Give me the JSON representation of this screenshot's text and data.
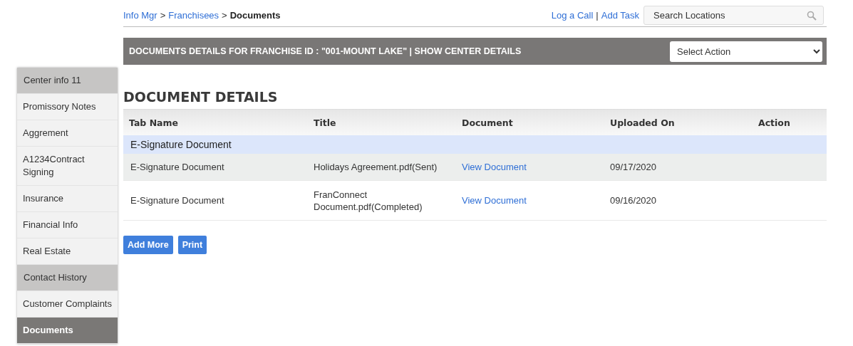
{
  "breadcrumb": {
    "items": [
      {
        "kind": "link",
        "label": "Info Mgr"
      },
      {
        "kind": "sep",
        "label": ">"
      },
      {
        "kind": "link",
        "label": "Franchisees"
      },
      {
        "kind": "sep",
        "label": ">"
      },
      {
        "kind": "current",
        "label": "Documents"
      }
    ]
  },
  "header_links": [
    {
      "kind": "link",
      "label": "Log a Call"
    },
    {
      "kind": "sep",
      "label": "|"
    },
    {
      "kind": "link",
      "label": "Add Task"
    }
  ],
  "search": {
    "placeholder": "Search Locations"
  },
  "title_bar": {
    "title": "DOCUMENTS DETAILS FOR FRANCHISE ID : \"001-MOUNT LAKE\" | SHOW CENTER DETAILS",
    "action_select": "Select Action"
  },
  "sidebar": {
    "items": [
      {
        "kind": "header",
        "label": "Center info 11",
        "selected": false
      },
      {
        "kind": "item",
        "label": "Promissory Notes",
        "selected": false
      },
      {
        "kind": "item",
        "label": "Aggrement",
        "selected": false
      },
      {
        "kind": "item",
        "label": "A1234Contract Signing",
        "selected": false
      },
      {
        "kind": "item",
        "label": "Insurance",
        "selected": false
      },
      {
        "kind": "item",
        "label": "Financial Info",
        "selected": false
      },
      {
        "kind": "item",
        "label": "Real Estate",
        "selected": false
      },
      {
        "kind": "header",
        "label": "Contact History",
        "selected": false
      },
      {
        "kind": "item",
        "label": "Customer Complaints",
        "selected": false
      },
      {
        "kind": "item",
        "label": "Documents",
        "selected": true
      }
    ]
  },
  "heading": "DOCUMENT DETAILS",
  "table": {
    "columns": [
      "Tab Name",
      "Title",
      "Document",
      "Uploaded On",
      "Action"
    ],
    "rows": [
      {
        "kind": "group",
        "tab_name": "E-Signature Document"
      },
      {
        "kind": "row",
        "tab_name": "E-Signature Document",
        "title": "Holidays Agreement.pdf(Sent)",
        "document": "View Document",
        "uploaded_on": "09/17/2020"
      },
      {
        "kind": "row",
        "tab_name": "E-Signature Document",
        "title": "FranConnect Document.pdf(Completed)",
        "document": "View Document",
        "uploaded_on": "09/16/2020"
      }
    ]
  },
  "buttons": [
    "Add More",
    "Print"
  ]
}
